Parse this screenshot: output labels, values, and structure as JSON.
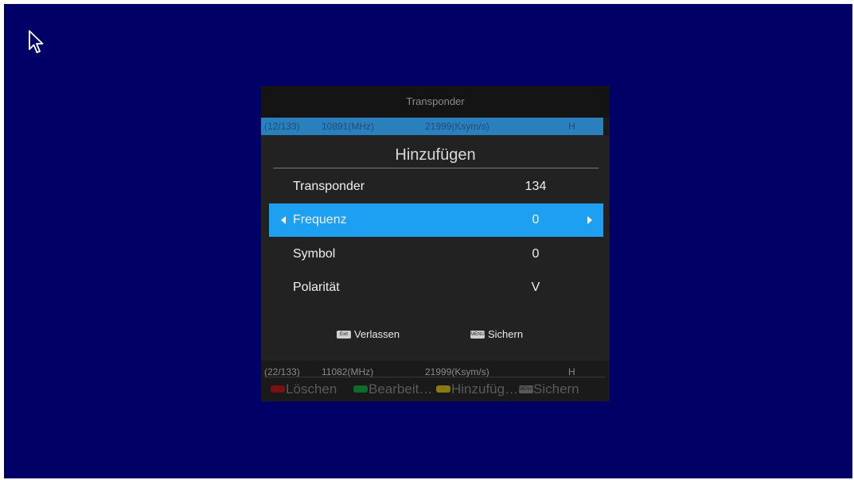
{
  "list": {
    "title": "Transponder",
    "rows": [
      {
        "index": "(12/133)",
        "freq": "10891(MHz)",
        "symbol": "21999(Ksym/s)",
        "pol": "H"
      },
      {
        "index": "(22/133)",
        "freq": "11082(MHz)",
        "symbol": "21999(Ksym/s)",
        "pol": "H"
      }
    ]
  },
  "footer": {
    "delete": "Löschen",
    "edit": "Bearbeit…",
    "add": "Hinzufüg…",
    "save": "Sichern",
    "menu_key": "MENU",
    "colors": {
      "red": "#7a1010",
      "green": "#0f6b2a",
      "yellow": "#8a7a12"
    }
  },
  "dialog": {
    "title": "Hinzufügen",
    "fields": [
      {
        "label": "Transponder",
        "value": "134"
      },
      {
        "label": "Frequenz",
        "value": "0"
      },
      {
        "label": "Symbol",
        "value": "0"
      },
      {
        "label": "Polarität",
        "value": "V"
      }
    ],
    "hints": {
      "exit_key": "Exit",
      "exit_label": "Verlassen",
      "menu_key": "MENU",
      "save_label": "Sichern"
    }
  },
  "colors": {
    "background": "#000066",
    "highlight": "#1ea0f2",
    "dialog_bg": "#222222"
  }
}
